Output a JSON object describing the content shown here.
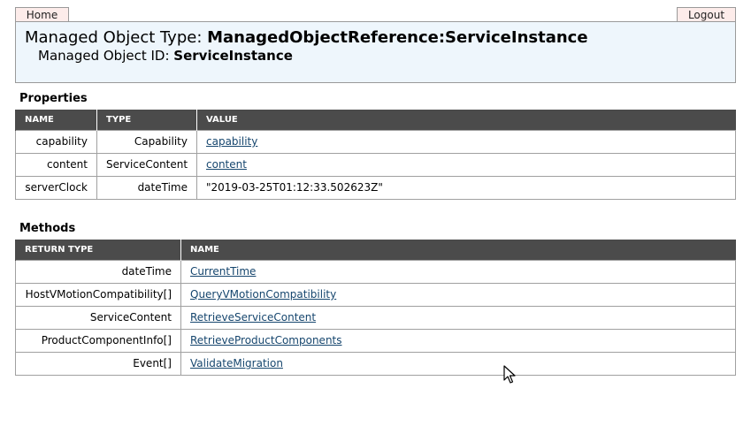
{
  "nav": {
    "home_label": "Home",
    "logout_label": "Logout"
  },
  "header": {
    "type_prefix": "Managed Object Type: ",
    "type_value": "ManagedObjectReference:ServiceInstance",
    "id_prefix": "Managed Object ID: ",
    "id_value": "ServiceInstance"
  },
  "properties": {
    "title": "Properties",
    "columns": [
      "NAME",
      "TYPE",
      "VALUE"
    ],
    "rows": [
      {
        "name": "capability",
        "type": "Capability",
        "value": "capability",
        "value_is_link": true
      },
      {
        "name": "content",
        "type": "ServiceContent",
        "value": "content",
        "value_is_link": true
      },
      {
        "name": "serverClock",
        "type": "dateTime",
        "value": "\"2019-03-25T01:12:33.502623Z\"",
        "value_is_link": false
      }
    ]
  },
  "methods": {
    "title": "Methods",
    "columns": [
      "RETURN TYPE",
      "NAME"
    ],
    "rows": [
      {
        "return_type": "dateTime",
        "name": "CurrentTime"
      },
      {
        "return_type": "HostVMotionCompatibility[]",
        "name": "QueryVMotionCompatibility"
      },
      {
        "return_type": "ServiceContent",
        "name": "RetrieveServiceContent"
      },
      {
        "return_type": "ProductComponentInfo[]",
        "name": "RetrieveProductComponents"
      },
      {
        "return_type": "Event[]",
        "name": "ValidateMigration"
      }
    ]
  },
  "colors": {
    "header_bg": "#eef6fc",
    "tab_bg": "#fdecea",
    "table_header_bg": "#4b4b4b",
    "link": "#16466e"
  }
}
